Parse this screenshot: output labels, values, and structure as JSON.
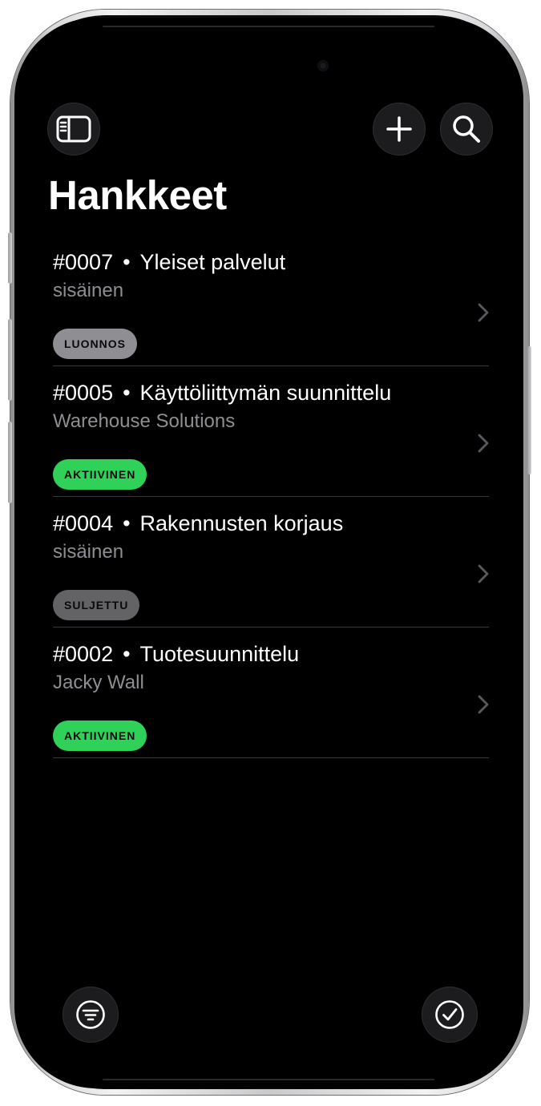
{
  "header": {
    "title": "Hankkeet",
    "sidebar_icon": "sidebar-icon",
    "add_icon": "plus-icon",
    "search_icon": "search-icon"
  },
  "projects": [
    {
      "number": "#0007",
      "separator": "•",
      "name": "Yleiset palvelut",
      "client": "sisäinen",
      "status": "LUONNOS",
      "status_color": "#8e8e93"
    },
    {
      "number": "#0005",
      "separator": "•",
      "name": "Käyttöliittymän suunnittelu",
      "client": "Warehouse Solutions",
      "status": "AKTIIVINEN",
      "status_color": "#30d158"
    },
    {
      "number": "#0004",
      "separator": "•",
      "name": "Rakennusten korjaus",
      "client": "sisäinen",
      "status": "SULJETTU",
      "status_color": "#636366"
    },
    {
      "number": "#0002",
      "separator": "•",
      "name": "Tuotesuunnittelu",
      "client": "Jacky Wall",
      "status": "AKTIIVINEN",
      "status_color": "#30d158"
    }
  ],
  "footer": {
    "filter_icon": "filter-icon",
    "select_icon": "checkmark-circle-icon"
  }
}
